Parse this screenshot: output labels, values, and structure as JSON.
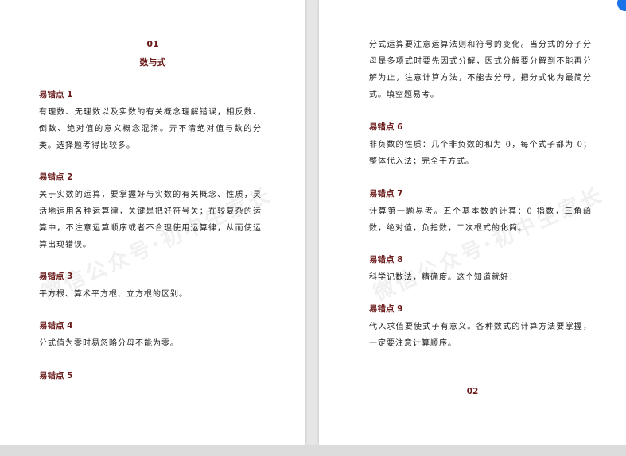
{
  "watermark": "微信公众号·初中生家长",
  "left_page": {
    "chapter_num": "01",
    "chapter_title": "数与式",
    "sections": [
      {
        "heading": "易错点 1",
        "body": "有理数、无理数以及实数的有关概念理解错误，相反数、倒数、绝对值的意义概念混淆。弄不清绝对值与数的分类。选择题考得比较多。"
      },
      {
        "heading": "易错点 2",
        "body": "关于实数的运算，要掌握好与实数的有关概念、性质，灵活地运用各种运算律，关键是把好符号关；在较复杂的运算中，不注意运算顺序或者不合理使用运算律，从而使运算出现错误。"
      },
      {
        "heading": "易错点 3",
        "body": "平方根、算术平方根、立方根的区别。"
      },
      {
        "heading": "易错点 4",
        "body": "分式值为零时易忽略分母不能为零。"
      },
      {
        "heading": "易错点 5",
        "body": ""
      }
    ]
  },
  "right_page": {
    "intro": "分式运算要注意运算法则和符号的变化。当分式的分子分母是多项式时要先因式分解，因式分解要分解到不能再分解为止，注意计算方法，不能去分母，把分式化为最简分式。填空题易考。",
    "sections": [
      {
        "heading": "易错点 6",
        "body": "非负数的性质：几个非负数的和为 0，每个式子都为 0；整体代入法；完全平方式。"
      },
      {
        "heading": "易错点 7",
        "body": "计算第一题易考。五个基本数的计算：0 指数，三角函数，绝对值，负指数，二次根式的化简。"
      },
      {
        "heading": "易错点 8",
        "body": "科学记数法，精确度。这个知道就好！"
      },
      {
        "heading": "易错点 9",
        "body": "代入求值要使式子有意义。各种数式的计算方法要掌握，一定要注意计算顺序。"
      }
    ],
    "page_number": "02"
  },
  "colors": {
    "heading": "#6b1a1a",
    "body_text": "#222222",
    "background": "#e6e6e6",
    "page": "#ffffff",
    "accent_button": "#1a73e8"
  }
}
